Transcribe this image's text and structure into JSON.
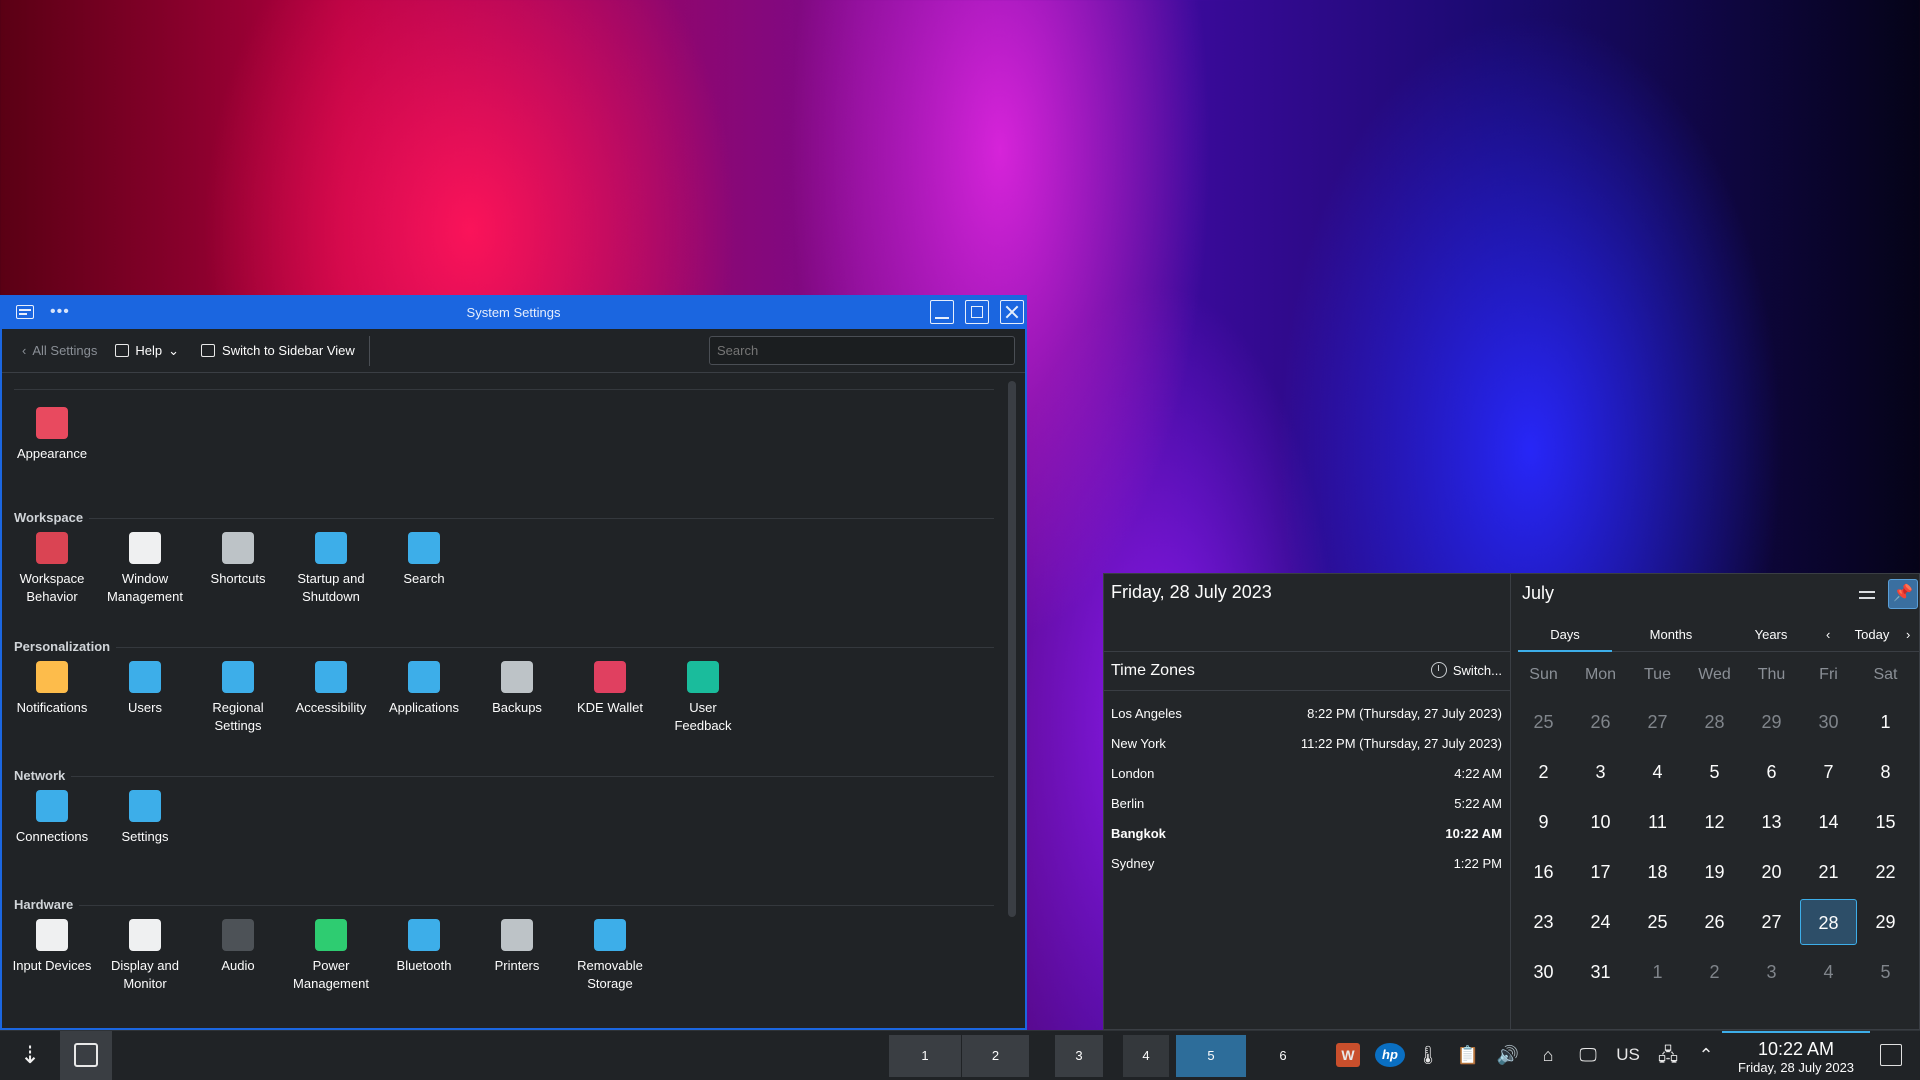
{
  "window": {
    "title": "System Settings",
    "toolbar": {
      "back_label": "All Settings",
      "help_label": "Help",
      "sidebar_label": "Switch to Sidebar View",
      "search_placeholder": "Search"
    },
    "top_items": [
      {
        "label": "Appearance",
        "icon": "appearance-icon",
        "color": "#e84a5f"
      }
    ],
    "sections": [
      {
        "title": "Workspace",
        "items": [
          {
            "label": "Workspace\nBehavior",
            "icon": "workspace-behavior-icon",
            "color": "#da4453"
          },
          {
            "label": "Window\nManagement",
            "icon": "window-management-icon",
            "color": "#eff0f1"
          },
          {
            "label": "Shortcuts",
            "icon": "keyboard-icon",
            "color": "#bdc3c7"
          },
          {
            "label": "Startup and\nShutdown",
            "icon": "startup-icon",
            "color": "#3daee9"
          },
          {
            "label": "Search",
            "icon": "search-icon",
            "color": "#3daee9"
          }
        ]
      },
      {
        "title": "Personalization",
        "items": [
          {
            "label": "Notifications",
            "icon": "bell-icon",
            "color": "#fdbc4b"
          },
          {
            "label": "Users",
            "icon": "users-icon",
            "color": "#3daee9"
          },
          {
            "label": "Regional\nSettings",
            "icon": "regional-icon",
            "color": "#3daee9"
          },
          {
            "label": "Accessibility",
            "icon": "accessibility-icon",
            "color": "#3daee9"
          },
          {
            "label": "Applications",
            "icon": "applications-icon",
            "color": "#3daee9"
          },
          {
            "label": "Backups",
            "icon": "backups-icon",
            "color": "#bdc3c7"
          },
          {
            "label": "KDE Wallet",
            "icon": "wallet-icon",
            "color": "#e04060"
          },
          {
            "label": "User\nFeedback",
            "icon": "feedback-icon",
            "color": "#1abc9c"
          }
        ]
      },
      {
        "title": "Network",
        "items": [
          {
            "label": "Connections",
            "icon": "globe-icon",
            "color": "#3daee9"
          },
          {
            "label": "Settings",
            "icon": "globe-settings-icon",
            "color": "#3daee9"
          }
        ]
      },
      {
        "title": "Hardware",
        "items": [
          {
            "label": "Input Devices",
            "icon": "mouse-icon",
            "color": "#eff0f1"
          },
          {
            "label": "Display and\nMonitor",
            "icon": "monitor-icon",
            "color": "#eff0f1"
          },
          {
            "label": "Audio",
            "icon": "speaker-icon",
            "color": "#4d5257"
          },
          {
            "label": "Power\nManagement",
            "icon": "power-icon",
            "color": "#2ecc71"
          },
          {
            "label": "Bluetooth",
            "icon": "bluetooth-icon",
            "color": "#3daee9"
          },
          {
            "label": "Printers",
            "icon": "printer-icon",
            "color": "#bdc3c7"
          },
          {
            "label": "Removable\nStorage",
            "icon": "usb-icon",
            "color": "#3daee9"
          }
        ]
      }
    ]
  },
  "calendar": {
    "full_date": "Friday, 28 July 2023",
    "timezones_title": "Time Zones",
    "switch_label": "Switch...",
    "timezones": [
      {
        "city": "Los Angeles",
        "time": "8:22 PM (Thursday, 27 July 2023)",
        "bold": false
      },
      {
        "city": "New York",
        "time": "11:22 PM (Thursday, 27 July 2023)",
        "bold": false
      },
      {
        "city": "London",
        "time": "4:22 AM",
        "bold": false
      },
      {
        "city": "Berlin",
        "time": "5:22 AM",
        "bold": false
      },
      {
        "city": "Bangkok",
        "time": "10:22 AM",
        "bold": true
      },
      {
        "city": "Sydney",
        "time": "1:22 PM",
        "bold": false
      }
    ],
    "month": "July",
    "tabs": [
      "Days",
      "Months",
      "Years"
    ],
    "today_label": "Today",
    "weekdays": [
      "Sun",
      "Mon",
      "Tue",
      "Wed",
      "Thu",
      "Fri",
      "Sat"
    ],
    "weeks": [
      [
        [
          "25",
          1
        ],
        [
          "26",
          1
        ],
        [
          "27",
          1
        ],
        [
          "28",
          1
        ],
        [
          "29",
          1
        ],
        [
          "30",
          1
        ],
        [
          "1",
          0
        ]
      ],
      [
        [
          "2",
          0
        ],
        [
          "3",
          0
        ],
        [
          "4",
          0
        ],
        [
          "5",
          0
        ],
        [
          "6",
          0
        ],
        [
          "7",
          0
        ],
        [
          "8",
          0
        ]
      ],
      [
        [
          "9",
          0
        ],
        [
          "10",
          0
        ],
        [
          "11",
          0
        ],
        [
          "12",
          0
        ],
        [
          "13",
          0
        ],
        [
          "14",
          0
        ],
        [
          "15",
          0
        ]
      ],
      [
        [
          "16",
          0
        ],
        [
          "17",
          0
        ],
        [
          "18",
          0
        ],
        [
          "19",
          0
        ],
        [
          "20",
          0
        ],
        [
          "21",
          0
        ],
        [
          "22",
          0
        ]
      ],
      [
        [
          "23",
          0
        ],
        [
          "24",
          0
        ],
        [
          "25",
          0
        ],
        [
          "26",
          0
        ],
        [
          "27",
          0
        ],
        [
          "28",
          2
        ],
        [
          "29",
          0
        ]
      ],
      [
        [
          "30",
          0
        ],
        [
          "31",
          0
        ],
        [
          "1",
          1
        ],
        [
          "2",
          1
        ],
        [
          "3",
          1
        ],
        [
          "4",
          1
        ],
        [
          "5",
          1
        ]
      ]
    ]
  },
  "taskbar": {
    "pager": [
      "1",
      "2",
      "3",
      "4",
      "5",
      "6"
    ],
    "tray": [
      "wps-office-icon",
      "hp-icon",
      "thermometer-icon",
      "clipboard-icon",
      "volume-icon",
      "usb-device-icon",
      "display-icon"
    ],
    "keyboard_layout": "US",
    "clock_time": "10:22 AM",
    "clock_date": "Friday, 28 July 2023"
  }
}
